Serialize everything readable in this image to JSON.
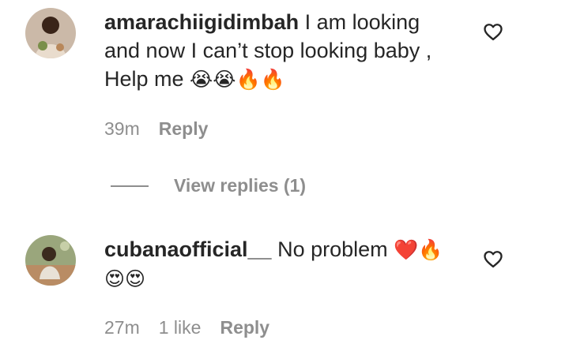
{
  "comments": [
    {
      "username": "amarachiigidimbah",
      "text": " I am looking and now I can’t stop looking baby , Help me ",
      "emojis": "😭😭🔥🔥",
      "time": "39m",
      "reply_label": "Reply"
    },
    {
      "username": "cubanaofficial__",
      "text": " No problem ",
      "emojis": "❤️🔥 😍😍",
      "time": "27m",
      "likes": "1 like",
      "reply_label": "Reply"
    }
  ],
  "view_replies": {
    "label": "View replies (1)"
  },
  "icons": {
    "like": "heart-outline-icon"
  },
  "colors": {
    "text": "#262626",
    "muted": "#8e8e8e"
  }
}
